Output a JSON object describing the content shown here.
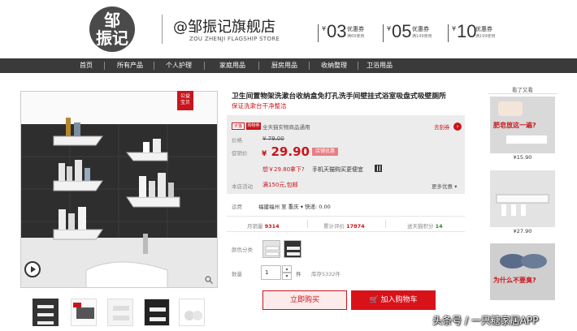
{
  "header": {
    "logo_text": "邹\n振记",
    "store_name": "@邹振记旗舰店",
    "store_name_en": "ZOU ZHENJI FLAGSHIP STORE",
    "coupons": [
      {
        "currency": "¥",
        "amount": "03",
        "label": "优惠券",
        "condition": "满69使用"
      },
      {
        "currency": "¥",
        "amount": "05",
        "label": "优惠券",
        "condition": "满149使用"
      },
      {
        "currency": "¥",
        "amount": "10",
        "label": "优惠券",
        "condition": "满199使用"
      }
    ]
  },
  "nav": {
    "items": [
      "首页",
      "所有产品",
      "个人护理",
      "家庭用品",
      "厨房用品",
      "收纳整理",
      "卫浴用品"
    ]
  },
  "gallery": {
    "badge": "公益\n宝贝",
    "thumb_count": 5
  },
  "product": {
    "title": "卫生间置物架洗漱台收纳盒免打孔洗手间壁挂式浴室吸盘式吸壁厕所",
    "subtitle": "保证洗漱台干净整洁"
  },
  "price_panel": {
    "badge_tmall": "天猫",
    "badge_shopping": "购物券",
    "promo_text": "全天猫实物商品通用",
    "promo_link": "去刮券",
    "price_label": "价格",
    "old_price": "¥ 79.00",
    "sale_label": "促销价",
    "sale_currency": "¥",
    "sale_price": "29.90",
    "sale_badge": "店铺优惠",
    "buy_text": "想￥29.80拿下?",
    "buy_text2": "手机天猫购买更便宜",
    "store_activity_label": "本店活动",
    "coupon_tag": "满150元,包邮",
    "more_offers": "更多优惠 ▾"
  },
  "shipping": {
    "label": "运费",
    "text": "福建福州 至 重庆 ▾ 快递: 0.00"
  },
  "stats": {
    "monthly_label": "月销量",
    "monthly": "9314",
    "reviews_label": "累计评价",
    "reviews": "17874",
    "points_label": "送天猫积分",
    "points": "14"
  },
  "options": {
    "color_label": "颜色分类",
    "qty_label": "数量",
    "qty_value": "1",
    "qty_unit": "件",
    "stock": "库存5332件"
  },
  "actions": {
    "buy_now": "立即购买",
    "add_cart": "加入购物车"
  },
  "rail": {
    "title": "看了又看",
    "items": [
      {
        "price": "¥15.90",
        "caption": "肥皂放这一遍?"
      },
      {
        "price": "¥27.90",
        "caption": ""
      },
      {
        "price": "",
        "caption": "为什么不要臭?"
      }
    ]
  },
  "watermark": "头条号 / 一只糖家居APP",
  "colors": {
    "accent": "#c8161d",
    "nav_bg": "#3a3a3a",
    "panel_bg": "#ececec"
  }
}
